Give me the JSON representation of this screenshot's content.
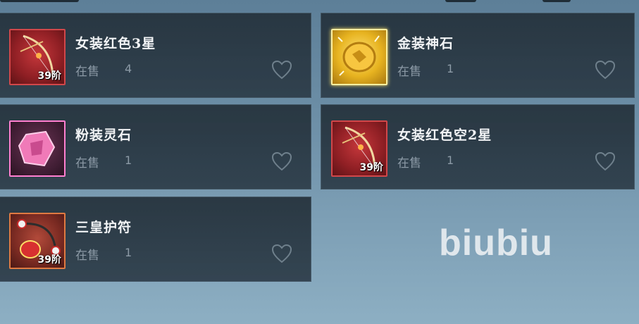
{
  "items": [
    {
      "name": "女装红色3星",
      "status": "在售",
      "count": "4",
      "tier": "39阶",
      "icon": "bow-icon",
      "rarity_color": "#d2474a"
    },
    {
      "name": "金装神石",
      "status": "在售",
      "count": "1",
      "tier": "",
      "icon": "gold-stone-icon",
      "rarity_color": "#ffe57a"
    },
    {
      "name": "粉装灵石",
      "status": "在售",
      "count": "1",
      "tier": "",
      "icon": "pink-stone-icon",
      "rarity_color": "#ff7fd0"
    },
    {
      "name": "女装红色空2星",
      "status": "在售",
      "count": "1",
      "tier": "39阶",
      "icon": "bow-icon",
      "rarity_color": "#d2474a"
    },
    {
      "name": "三皇护符",
      "status": "在售",
      "count": "1",
      "tier": "39阶",
      "icon": "amulet-icon",
      "rarity_color": "#e07a42"
    }
  ],
  "watermark": "biubiu"
}
